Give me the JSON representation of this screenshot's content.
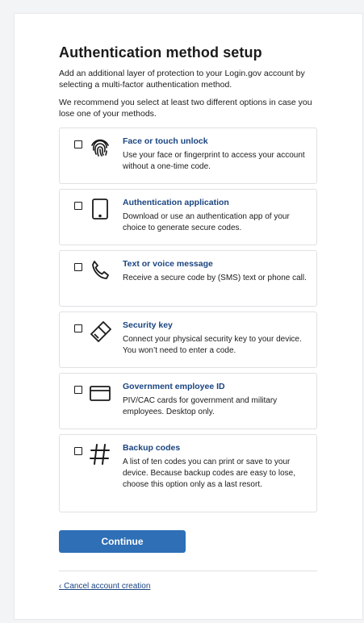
{
  "page": {
    "title": "Authentication method setup",
    "intro_1": "Add an additional layer of protection to your Login.gov account by selecting a multi-factor authentication method.",
    "intro_2": "We recommend you select at least two different options in case you lose one of your methods."
  },
  "options": [
    {
      "icon": "fingerprint-icon",
      "title": "Face or touch unlock",
      "description": "Use your face or fingerprint to access your account without a one-time code."
    },
    {
      "icon": "tablet-icon",
      "title": "Authentication application",
      "description": "Download or use an authentication app of your choice to generate secure codes."
    },
    {
      "icon": "phone-icon",
      "title": "Text or voice message",
      "description": "Receive a secure code by (SMS) text or phone call."
    },
    {
      "icon": "security-key-icon",
      "title": "Security key",
      "description": "Connect your physical security key to your device. You won’t need to enter a code."
    },
    {
      "icon": "id-card-icon",
      "title": "Government employee ID",
      "description": "PIV/CAC cards for government and military employees. Desktop only."
    },
    {
      "icon": "hashtag-icon",
      "title": "Backup codes",
      "description": "A list of ten codes you can print or save to your device. Because backup codes are easy to lose, choose this option only as a last resort."
    }
  ],
  "actions": {
    "continue_label": "Continue",
    "cancel_label": "‹ Cancel account creation"
  },
  "colors": {
    "link": "#1a4480",
    "button": "#2e6fb6",
    "border": "#dfe1e2"
  }
}
